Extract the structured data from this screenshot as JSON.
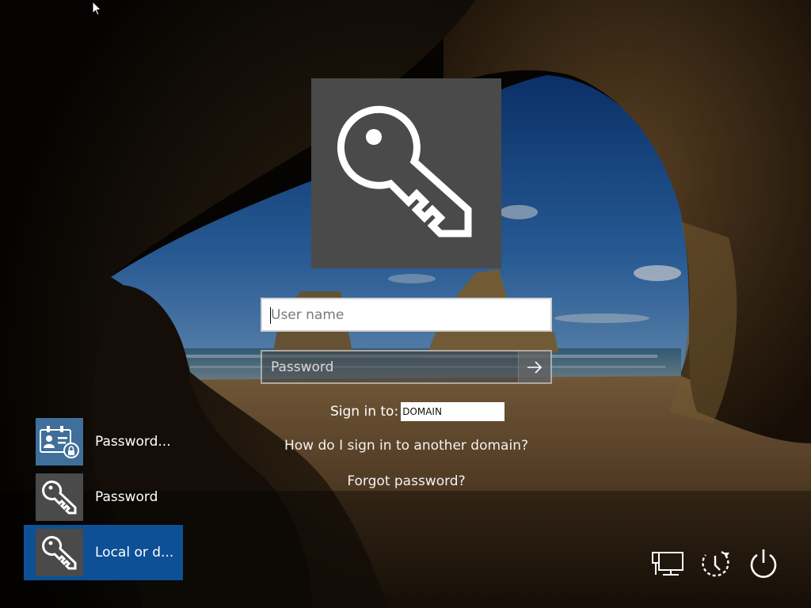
{
  "login": {
    "username_placeholder": "User name",
    "password_placeholder": "Password",
    "sign_in_to_label": "Sign in to:",
    "domain_value": "DOMAIN",
    "other_domain_link": "How do I sign in to another domain?",
    "forgot_password_link": "Forgot password?",
    "user_tile_icon": "key-icon"
  },
  "sign_in_options": [
    {
      "label": "Password...",
      "icon": "smartcard-icon",
      "selected": false
    },
    {
      "label": "Password",
      "icon": "key-icon",
      "selected": false
    },
    {
      "label": "Local or d...",
      "icon": "key-icon",
      "selected": true
    }
  ],
  "corner_buttons": [
    {
      "icon": "network-icon"
    },
    {
      "icon": "ease-of-access-icon"
    },
    {
      "icon": "power-icon"
    }
  ],
  "colors": {
    "selected_option": "#0e5096",
    "tile_gray": "#4a4a4a"
  }
}
